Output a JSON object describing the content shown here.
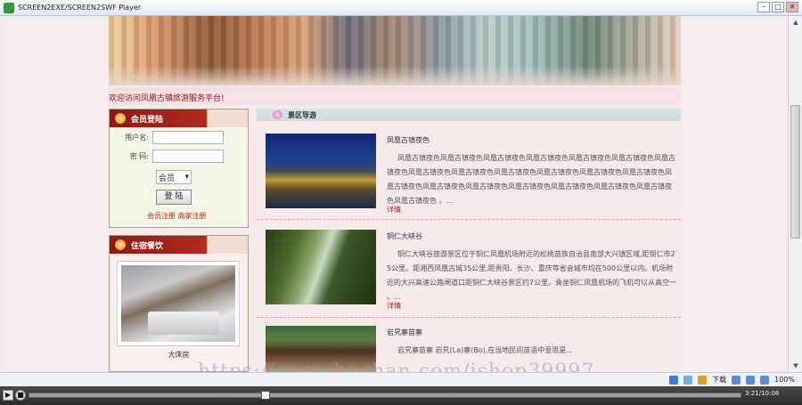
{
  "window": {
    "title": "SCREEN2EXE/SCREEN2SWF Player",
    "minimize": "–",
    "maximize": "□",
    "close": "✕"
  },
  "page": {
    "welcome": "欢迎访问凤凰古镇旅游服务平台!"
  },
  "login": {
    "heading": "会员登陆",
    "username_label": "用户名:",
    "username_value": "",
    "password_label": "密  码:",
    "password_value": "",
    "role_selected": "会员",
    "submit_label": "登 陆",
    "register_links": "会员注册 商家注册"
  },
  "accommodation": {
    "heading": "住宿餐饮",
    "room_caption": "大床房"
  },
  "guide": {
    "heading": "景区导游",
    "spots": [
      {
        "title": "凤凰古镇夜色",
        "description": "凤凰古镇夜色凤凰古镇夜色凤凰古镇夜色凤凰古镇夜色凤凰古镇夜色凤凰古镇夜色凤凰古镇夜色凤凰古镇夜色凤凰古镇夜色凤凰古镇夜色凤凰古镇夜色凤凰古镇夜色凤凰古镇夜色凤凰古镇夜色凤凰古镇夜色凤凰古镇夜色凤凰古镇夜色凤凰古镇夜色凤凰古镇夜色凤凰古镇夜色凤凰古镇夜色 。...",
        "more": "详情"
      },
      {
        "title": "铜仁大峡谷",
        "description": "铜仁大峡谷旅游景区位于铜仁凤凰机场附近的松桃苗族自治县南部大兴镇区域,距铜仁市25公里。距湘西凤凰古城35公里,距贵阳、长沙、重庆等省会城市均在500公里以内。机场附近的大兴高速公路闸道口距铜仁大峡谷景区约7公里。乘坐铜仁凤凰机场的飞机可以从高空一 。...",
        "more": "详情"
      },
      {
        "title": "岩旯寨苗寨",
        "description": "岩旯寨苗寨 岩旯(La)寨(Bo),在当地民间苗语中意思是...",
        "more": ""
      }
    ]
  },
  "watermark": "https://www.huzhan.com/ishop39997",
  "statusbar": {
    "download_label": "下载",
    "zoom": "100%"
  },
  "player": {
    "play": "▶",
    "stop": "■",
    "time": "3:21/10:08",
    "progress": 0.33
  },
  "scrollbar": {
    "up": "▲",
    "down": "▼"
  }
}
